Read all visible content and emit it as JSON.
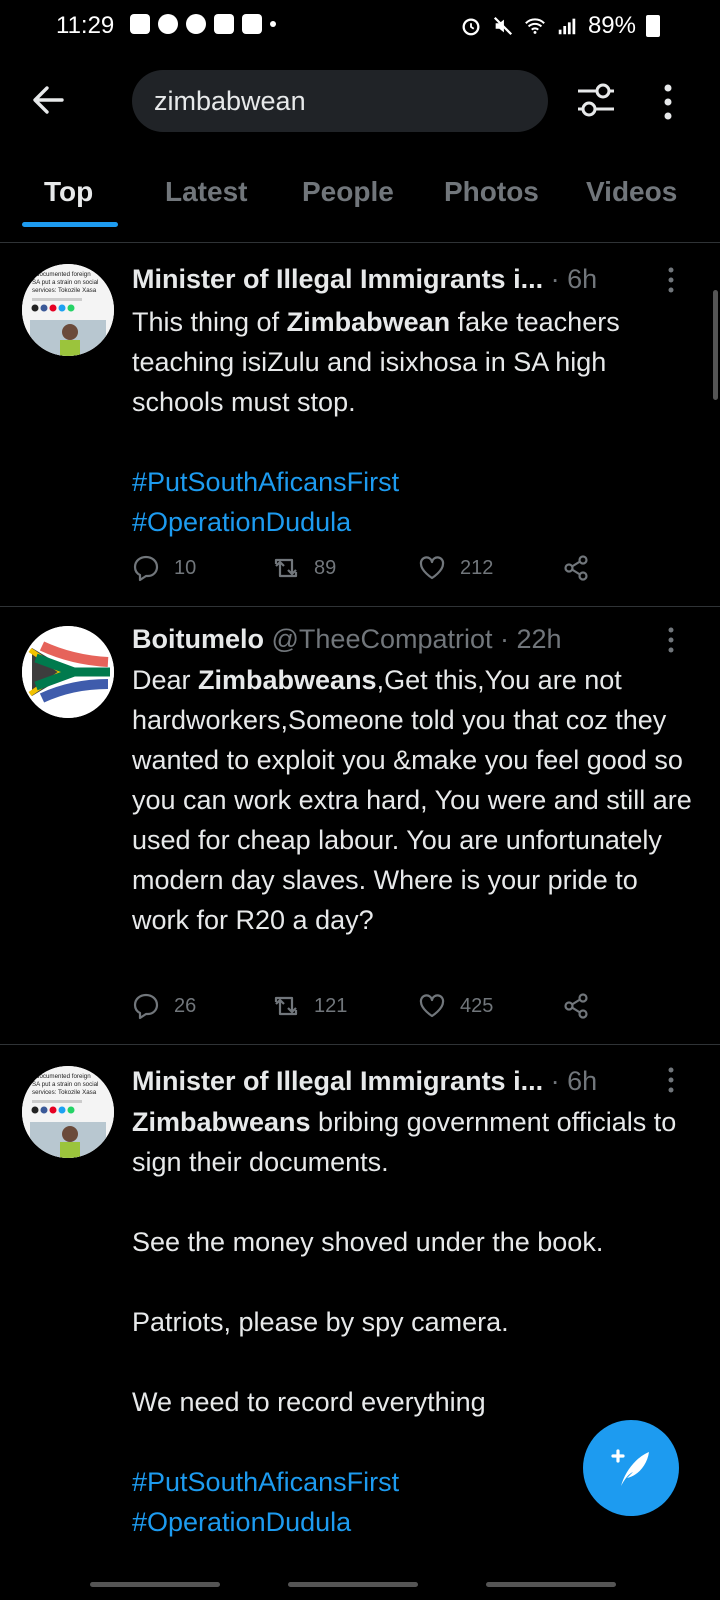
{
  "status": {
    "time": "11:29",
    "battery": "89%"
  },
  "search": {
    "query": "zimbabwean"
  },
  "tabs": [
    {
      "label": "Top"
    },
    {
      "label": "Latest"
    },
    {
      "label": "People"
    },
    {
      "label": "Photos"
    },
    {
      "label": "Videos"
    }
  ],
  "tweets": [
    {
      "name": "Minister of Illegal Immigrants i...",
      "handle": "",
      "time": "· 6h",
      "text": [
        {
          "t": "This thing of "
        },
        {
          "b": "Zimbabwean"
        },
        {
          "t": " fake teachers teaching isiZulu and isixhosa in SA high schools must stop.\n\n"
        },
        {
          "h": "#PutSouthAficansFirst"
        },
        {
          "t": "\n"
        },
        {
          "h": "#OperationDudula"
        }
      ],
      "replies": "10",
      "retweets": "89",
      "likes": "212"
    },
    {
      "name": "Boitumelo",
      "handle": "@TheeCompatriot",
      "time": "· 22h",
      "text": [
        {
          "t": "Dear "
        },
        {
          "b": "Zimbabweans"
        },
        {
          "t": ",Get this,You are not hardworkers,Someone told you that coz they wanted to exploit you &make you feel good so you can work extra hard, You were and still are used for cheap labour. You are unfortunately modern day slaves. Where is your pride to work for R20 a day?"
        }
      ],
      "replies": "26",
      "retweets": "121",
      "likes": "425"
    },
    {
      "name": "Minister of Illegal Immigrants i...",
      "handle": "",
      "time": "· 6h",
      "text": [
        {
          "b": "Zimbabweans"
        },
        {
          "t": " bribing government officials to sign their documents.\n\nSee the money shoved under the book.\n\nPatriots, please by spy camera.\n\nWe need to record everything\n\n"
        },
        {
          "h": "#PutSouthAficansFirst"
        },
        {
          "t": "\n"
        },
        {
          "h": "#OperationDudula"
        }
      ]
    }
  ],
  "avatar_article": {
    "headline": "documented foreign SA put a strain on social services: Tokozile Xasa"
  },
  "colors": {
    "accent": "#1d9bf0",
    "muted": "#71767b",
    "bg": "#000000"
  }
}
